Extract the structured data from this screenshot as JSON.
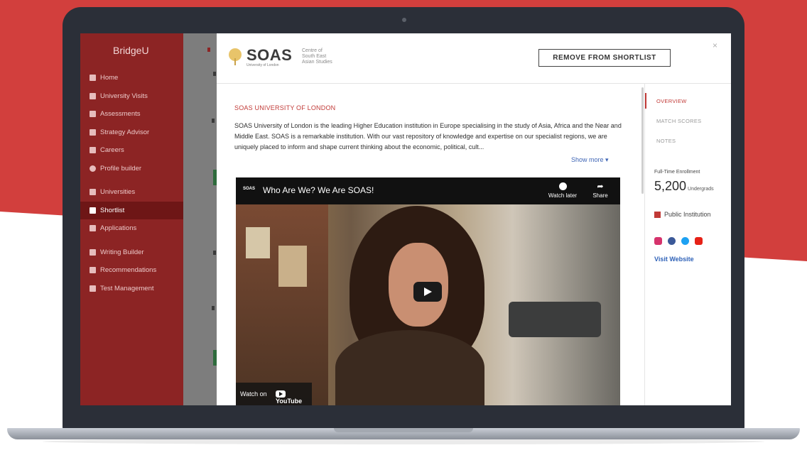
{
  "colors": {
    "accent_red": "#c13a37",
    "sidebar": "#8c2424",
    "link_blue": "#2f62b8",
    "laptop": "#2b2f38"
  },
  "sidebar": {
    "brand": "BridgeU",
    "items": [
      {
        "label": "Home",
        "icon": "home-icon"
      },
      {
        "label": "University Visits",
        "icon": "calendar-icon"
      },
      {
        "label": "Assessments",
        "icon": "document-icon"
      },
      {
        "label": "Strategy Advisor",
        "icon": "fork-icon"
      },
      {
        "label": "Careers",
        "icon": "briefcase-icon"
      },
      {
        "label": "Profile builder",
        "icon": "user-icon"
      },
      {
        "label": "Universities",
        "icon": "people-icon"
      },
      {
        "label": "Shortlist",
        "icon": "bookmark-icon"
      },
      {
        "label": "Applications",
        "icon": "clipboard-icon"
      },
      {
        "label": "Writing Builder",
        "icon": "pencil-icon"
      },
      {
        "label": "Recommendations",
        "icon": "mail-icon"
      },
      {
        "label": "Test Management",
        "icon": "copy-icon"
      }
    ],
    "active_index": 7
  },
  "modal": {
    "logo_text": "SOAS",
    "logo_sub": "University of London",
    "logo_tagline": "Centre of South East Asian Studies",
    "remove_label": "REMOVE FROM SHORTLIST",
    "close_label": "×",
    "university_name": "SOAS UNIVERSITY OF LONDON",
    "description": "SOAS University of London is the leading Higher Education institution in Europe specialising in the study of Asia, Africa and the Near and Middle East. SOAS is a remarkable institution. With our vast repository of knowledge and expertise on our specialist regions, we are uniquely placed to inform and shape current thinking about the economic, political, cult...",
    "show_more": "Show more ▾",
    "video": {
      "channel": "SOAS",
      "title": "Who Are We? We Are SOAS!",
      "watch_later": "Watch later",
      "share": "Share",
      "watch_on": "Watch on",
      "youtube": "YouTube"
    },
    "tabs": [
      "OVERVIEW",
      "MATCH SCORES",
      "NOTES"
    ],
    "active_tab": 0,
    "enrollment_label": "Full-Time Enrollment",
    "enrollment_value": "5,200",
    "enrollment_unit": "Undergrads",
    "institution_type": "Public Institution",
    "visit_website": "Visit Website"
  }
}
